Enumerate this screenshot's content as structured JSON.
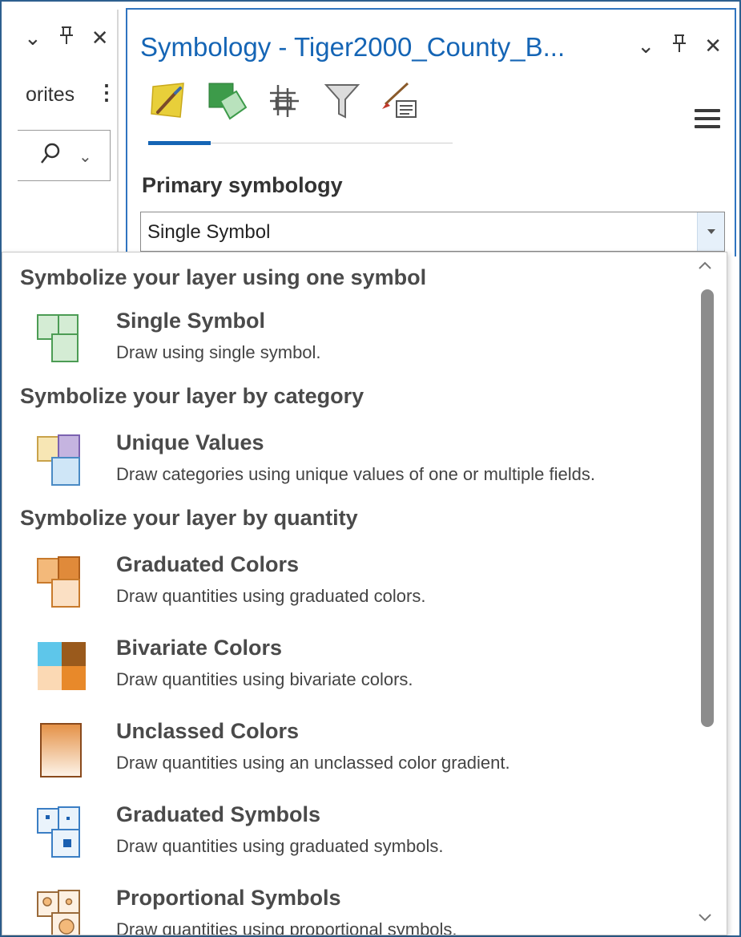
{
  "left_pane": {
    "favorites_partial": "orites",
    "header_icons": [
      "chevron-down-icon",
      "pin-icon",
      "close-icon"
    ]
  },
  "symbology_pane": {
    "title": "Symbology - Tiger2000_County_B...",
    "header_icons": [
      "chevron-down-icon",
      "pin-icon",
      "close-icon"
    ],
    "tabs": [
      {
        "icon": "primary-symbology-icon",
        "active": true
      },
      {
        "icon": "vary-symbology-icon",
        "active": false
      },
      {
        "icon": "symbol-layer-drawing-icon",
        "active": false
      },
      {
        "icon": "feature-level-masking-icon",
        "active": false
      },
      {
        "icon": "label-properties-icon",
        "active": false
      }
    ],
    "primary_label": "Primary symbology",
    "combo_value": "Single Symbol"
  },
  "dropdown": {
    "groups": [
      {
        "header": "Symbolize your layer using one symbol",
        "items": [
          {
            "name": "Single Symbol",
            "desc": "Draw using single symbol.",
            "icon": "single-symbol-icon"
          }
        ]
      },
      {
        "header": "Symbolize your layer by category",
        "items": [
          {
            "name": "Unique Values",
            "desc": "Draw categories using unique values of one or multiple fields.",
            "icon": "unique-values-icon"
          }
        ]
      },
      {
        "header": "Symbolize your layer by quantity",
        "items": [
          {
            "name": "Graduated Colors",
            "desc": "Draw quantities using graduated colors.",
            "icon": "graduated-colors-icon"
          },
          {
            "name": "Bivariate Colors",
            "desc": "Draw quantities using bivariate colors.",
            "icon": "bivariate-colors-icon"
          },
          {
            "name": "Unclassed Colors",
            "desc": "Draw quantities using an unclassed color gradient.",
            "icon": "unclassed-colors-icon"
          },
          {
            "name": "Graduated Symbols",
            "desc": "Draw quantities using graduated symbols.",
            "icon": "graduated-symbols-icon"
          },
          {
            "name": "Proportional Symbols",
            "desc": "Draw quantities using proportional symbols.",
            "icon": "proportional-symbols-icon"
          }
        ]
      }
    ]
  },
  "colors": {
    "accent": "#1565b5",
    "pane_border": "#2f74c0"
  }
}
